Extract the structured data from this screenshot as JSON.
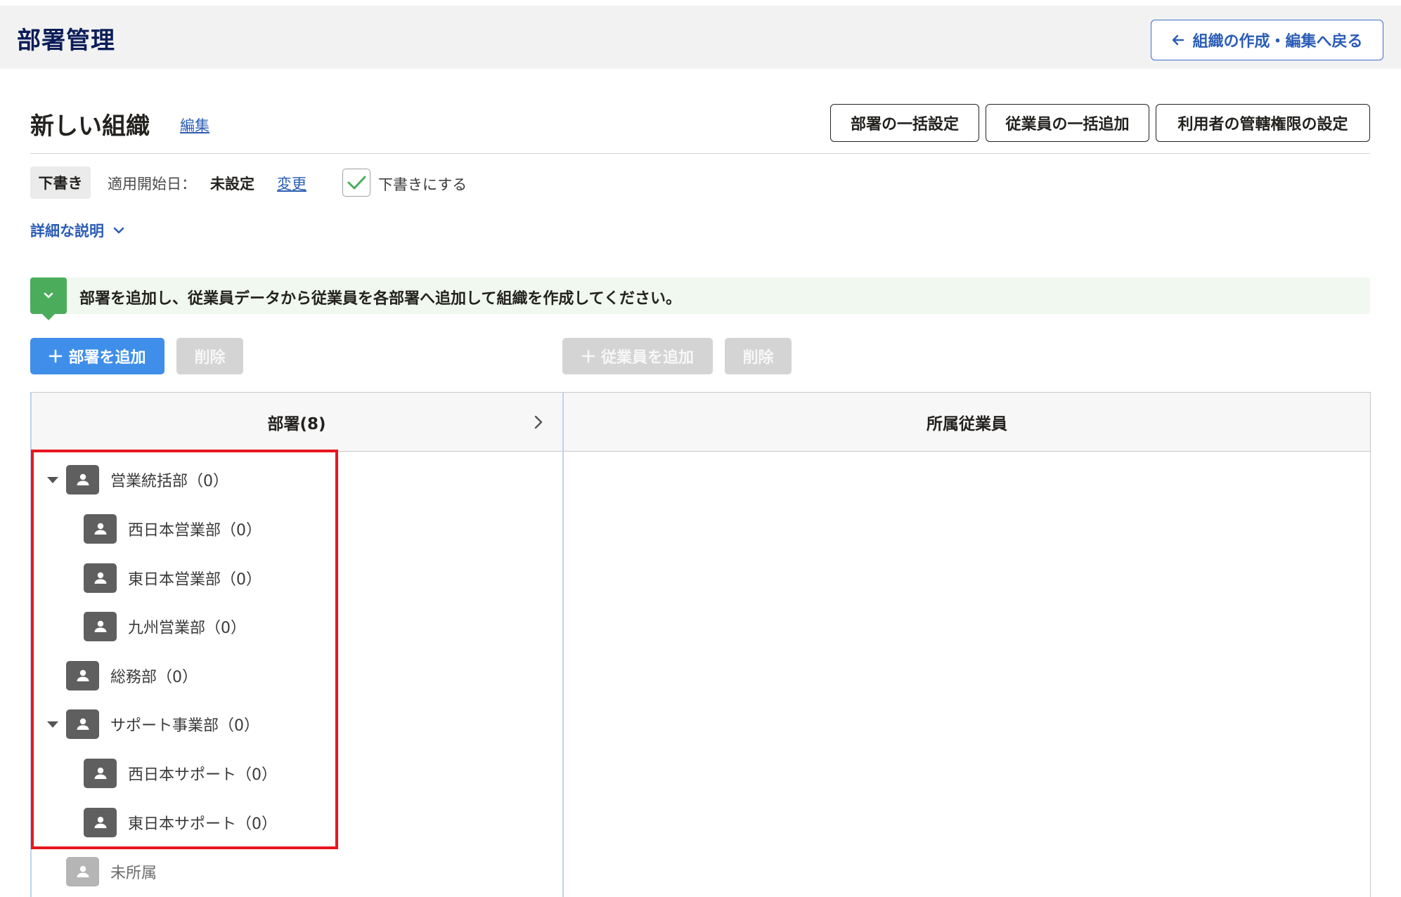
{
  "header": {
    "title": "部署管理",
    "back_label": "組織の作成・編集へ戻る"
  },
  "org": {
    "name": "新しい組織",
    "edit_label": "編集"
  },
  "actions": {
    "bulk_dept": "部署の一括設定",
    "bulk_employee": "従業員の一括追加",
    "admin_rights": "利用者の管轄権限の設定"
  },
  "status": {
    "badge": "下書き",
    "start_label": "適用開始日：",
    "start_value": "未設定",
    "change_label": "変更",
    "draft_checkbox_label": "下書きにする",
    "draft_checked": true
  },
  "details_label": "詳細な説明",
  "info_message": "部署を追加し、従業員データから従業員を各部署へ追加して組織を作成してください。",
  "toolbar": {
    "add_dept": "部署を追加",
    "delete_dept": "削除",
    "add_employee": "従業員を追加",
    "delete_employee": "削除"
  },
  "table": {
    "dept_header": "部署(8)",
    "members_header": "所属従業員"
  },
  "tree": [
    {
      "label": "営業統括部（0）",
      "expanded": true
    },
    {
      "label": "西日本営業部（0）"
    },
    {
      "label": "東日本営業部（0）"
    },
    {
      "label": "九州営業部（0）"
    },
    {
      "label": "総務部（0）"
    },
    {
      "label": "サポート事業部（0）",
      "expanded": true
    },
    {
      "label": "西日本サポート（0）"
    },
    {
      "label": "東日本サポート（0）"
    },
    {
      "label": "未所属"
    }
  ],
  "colors": {
    "title_navy": "#0c1d59",
    "link_blue": "#2b5db6",
    "primary_button": "#3f8fea",
    "success_green": "#4bad5c",
    "highlight_red": "#e8161e"
  }
}
